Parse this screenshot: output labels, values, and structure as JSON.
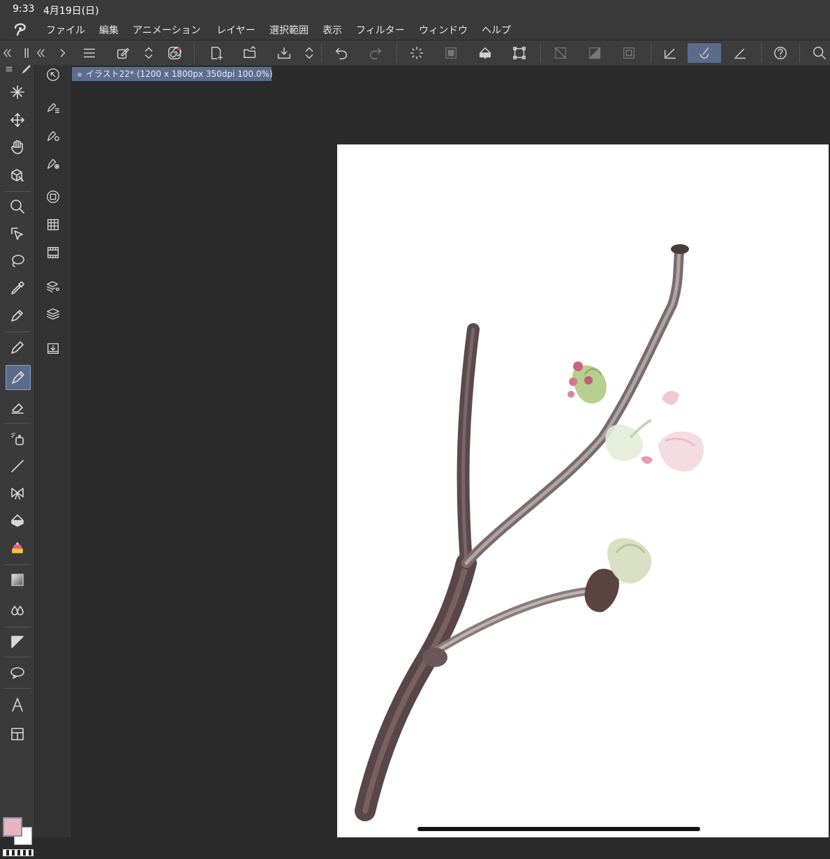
{
  "status": {
    "time": "9:33",
    "date": "4月19日(日)"
  },
  "menu": [
    "ファイル",
    "編集",
    "アニメーション",
    "レイヤー",
    "選択範囲",
    "表示",
    "フィルター",
    "ウィンドウ",
    "ヘルプ"
  ],
  "toolbar": {
    "icons": [
      "menu-icon",
      "edit-icon",
      "up-down-icon",
      "spiral-icon",
      "new-document-icon",
      "open-folder-icon",
      "save-icon",
      "up-down-icon",
      "undo-icon",
      "redo-icon",
      "loading-icon",
      "select-all-icon",
      "fill-icon",
      "transform-icon",
      "deselect-icon",
      "invert-selection-icon",
      "selection-border-icon",
      "ruler-icon",
      "brush-stabilizer-icon",
      "pen-settings-icon",
      "help-icon",
      "search-icon"
    ]
  },
  "document": {
    "tab_label": "イラスト22* (1200 x 1800px 350dpi 100.0%)"
  },
  "colors": {
    "accent": "#5b6b8c",
    "main_color": "#e8b4c0",
    "sub_color": "#ffffff"
  },
  "tools": [
    "sparkle-icon",
    "move-icon",
    "hand-icon",
    "object-select-icon",
    "zoom-icon",
    "select-icon",
    "lasso-icon",
    "eyedropper-icon",
    "pen-icon",
    "pencil-icon",
    "brush-icon",
    "eraser-icon",
    "airbrush-icon",
    "line-icon",
    "decoration-icon",
    "fill-icon",
    "cake-icon",
    "gradient-icon",
    "blend-icon",
    "frame-icon",
    "balloon-icon",
    "text-icon",
    "layout-icon"
  ],
  "sub_tools": [
    "navigator-icon",
    "sub-tool-icon",
    "tool-property-icon",
    "brush-size-icon",
    "color-wheel-icon",
    "color-set-icon",
    "timeline-icon",
    "layer-property-icon",
    "layer-icon",
    "material-icon"
  ]
}
